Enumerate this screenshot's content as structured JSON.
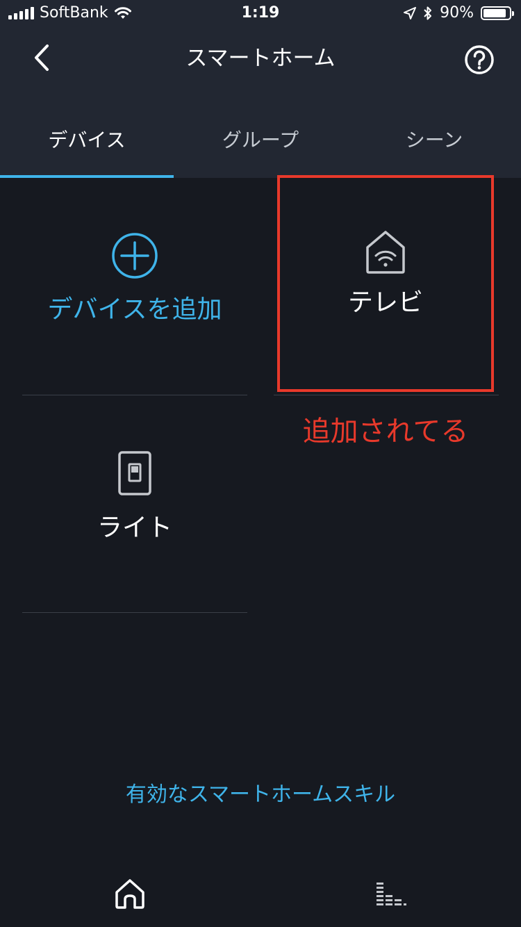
{
  "status_bar": {
    "carrier": "SoftBank",
    "time": "1:19",
    "battery_percent": "90%",
    "battery_level": 0.9,
    "icons": [
      "signal-icon",
      "wifi-icon",
      "location-icon",
      "bluetooth-icon",
      "battery-icon"
    ]
  },
  "header": {
    "title": "スマートホーム",
    "back_icon": "chevron-left-icon",
    "help_icon": "help-icon"
  },
  "tabs": [
    {
      "label": "デバイス",
      "active": true
    },
    {
      "label": "グループ",
      "active": false
    },
    {
      "label": "シーン",
      "active": false
    }
  ],
  "devices": {
    "add_label": "デバイスを追加",
    "items": [
      {
        "label": "テレビ",
        "icon": "smart-home-icon"
      },
      {
        "label": "ライト",
        "icon": "light-switch-icon"
      }
    ]
  },
  "annotation": {
    "text": "追加されてる",
    "color": "#e8392b"
  },
  "skills_link": "有効なスマートホームスキル",
  "bottom_nav": {
    "items": [
      "home-icon",
      "activity-icon"
    ]
  },
  "colors": {
    "accent": "#3fb4ea",
    "background": "#161920",
    "header": "#222732",
    "annotation": "#e8392b"
  }
}
